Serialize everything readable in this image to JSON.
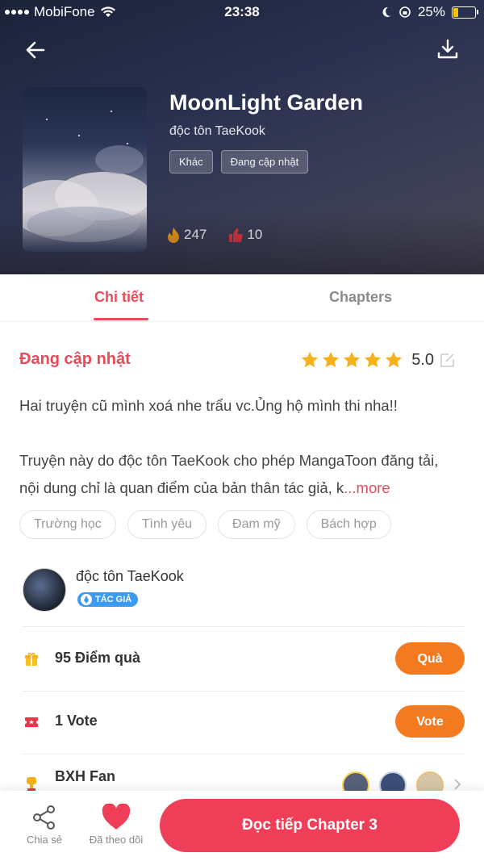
{
  "status_bar": {
    "carrier": "MobiFone",
    "time": "23:38",
    "battery": "25%"
  },
  "book": {
    "title": "MoonLight Garden",
    "author": "độc tôn TaeKook",
    "tags": [
      "Khác",
      "Đang cập nhật"
    ],
    "views": "247",
    "likes": "10"
  },
  "tabs": [
    {
      "label": "Chi tiết"
    },
    {
      "label": "Chapters"
    }
  ],
  "details": {
    "status": "Đang cập nhật",
    "rating": "5.0",
    "stars": 5,
    "description_1": "Hai truyện cũ mình xoá nhe trẩu vc.Ủng hộ mình thi nha!!",
    "description_2": "Truyện này do độc tôn TaeKook cho phép MangaToon đăng tải, nội dung chỉ là quan điểm của bản thân tác giả, k",
    "more": "...more",
    "genres": [
      "Trường học",
      "Tình yêu",
      "Đam mỹ",
      "Bách hợp"
    ]
  },
  "author_section": {
    "name": "độc tôn TaeKook",
    "badge": "TÁC GIẢ"
  },
  "gift": {
    "label": "95 Điểm quà",
    "button": "Quà"
  },
  "vote": {
    "label": "1 Vote",
    "button": "Vote"
  },
  "fans": {
    "label": "BXH Fan"
  },
  "bottom_bar": {
    "share": "Chia sẻ",
    "follow": "Đã theo dõi",
    "read": "Đọc tiếp Chapter 3"
  },
  "colors": {
    "accent": "#ea4a5a",
    "orange": "#f47a20",
    "star": "#f5b21c"
  }
}
